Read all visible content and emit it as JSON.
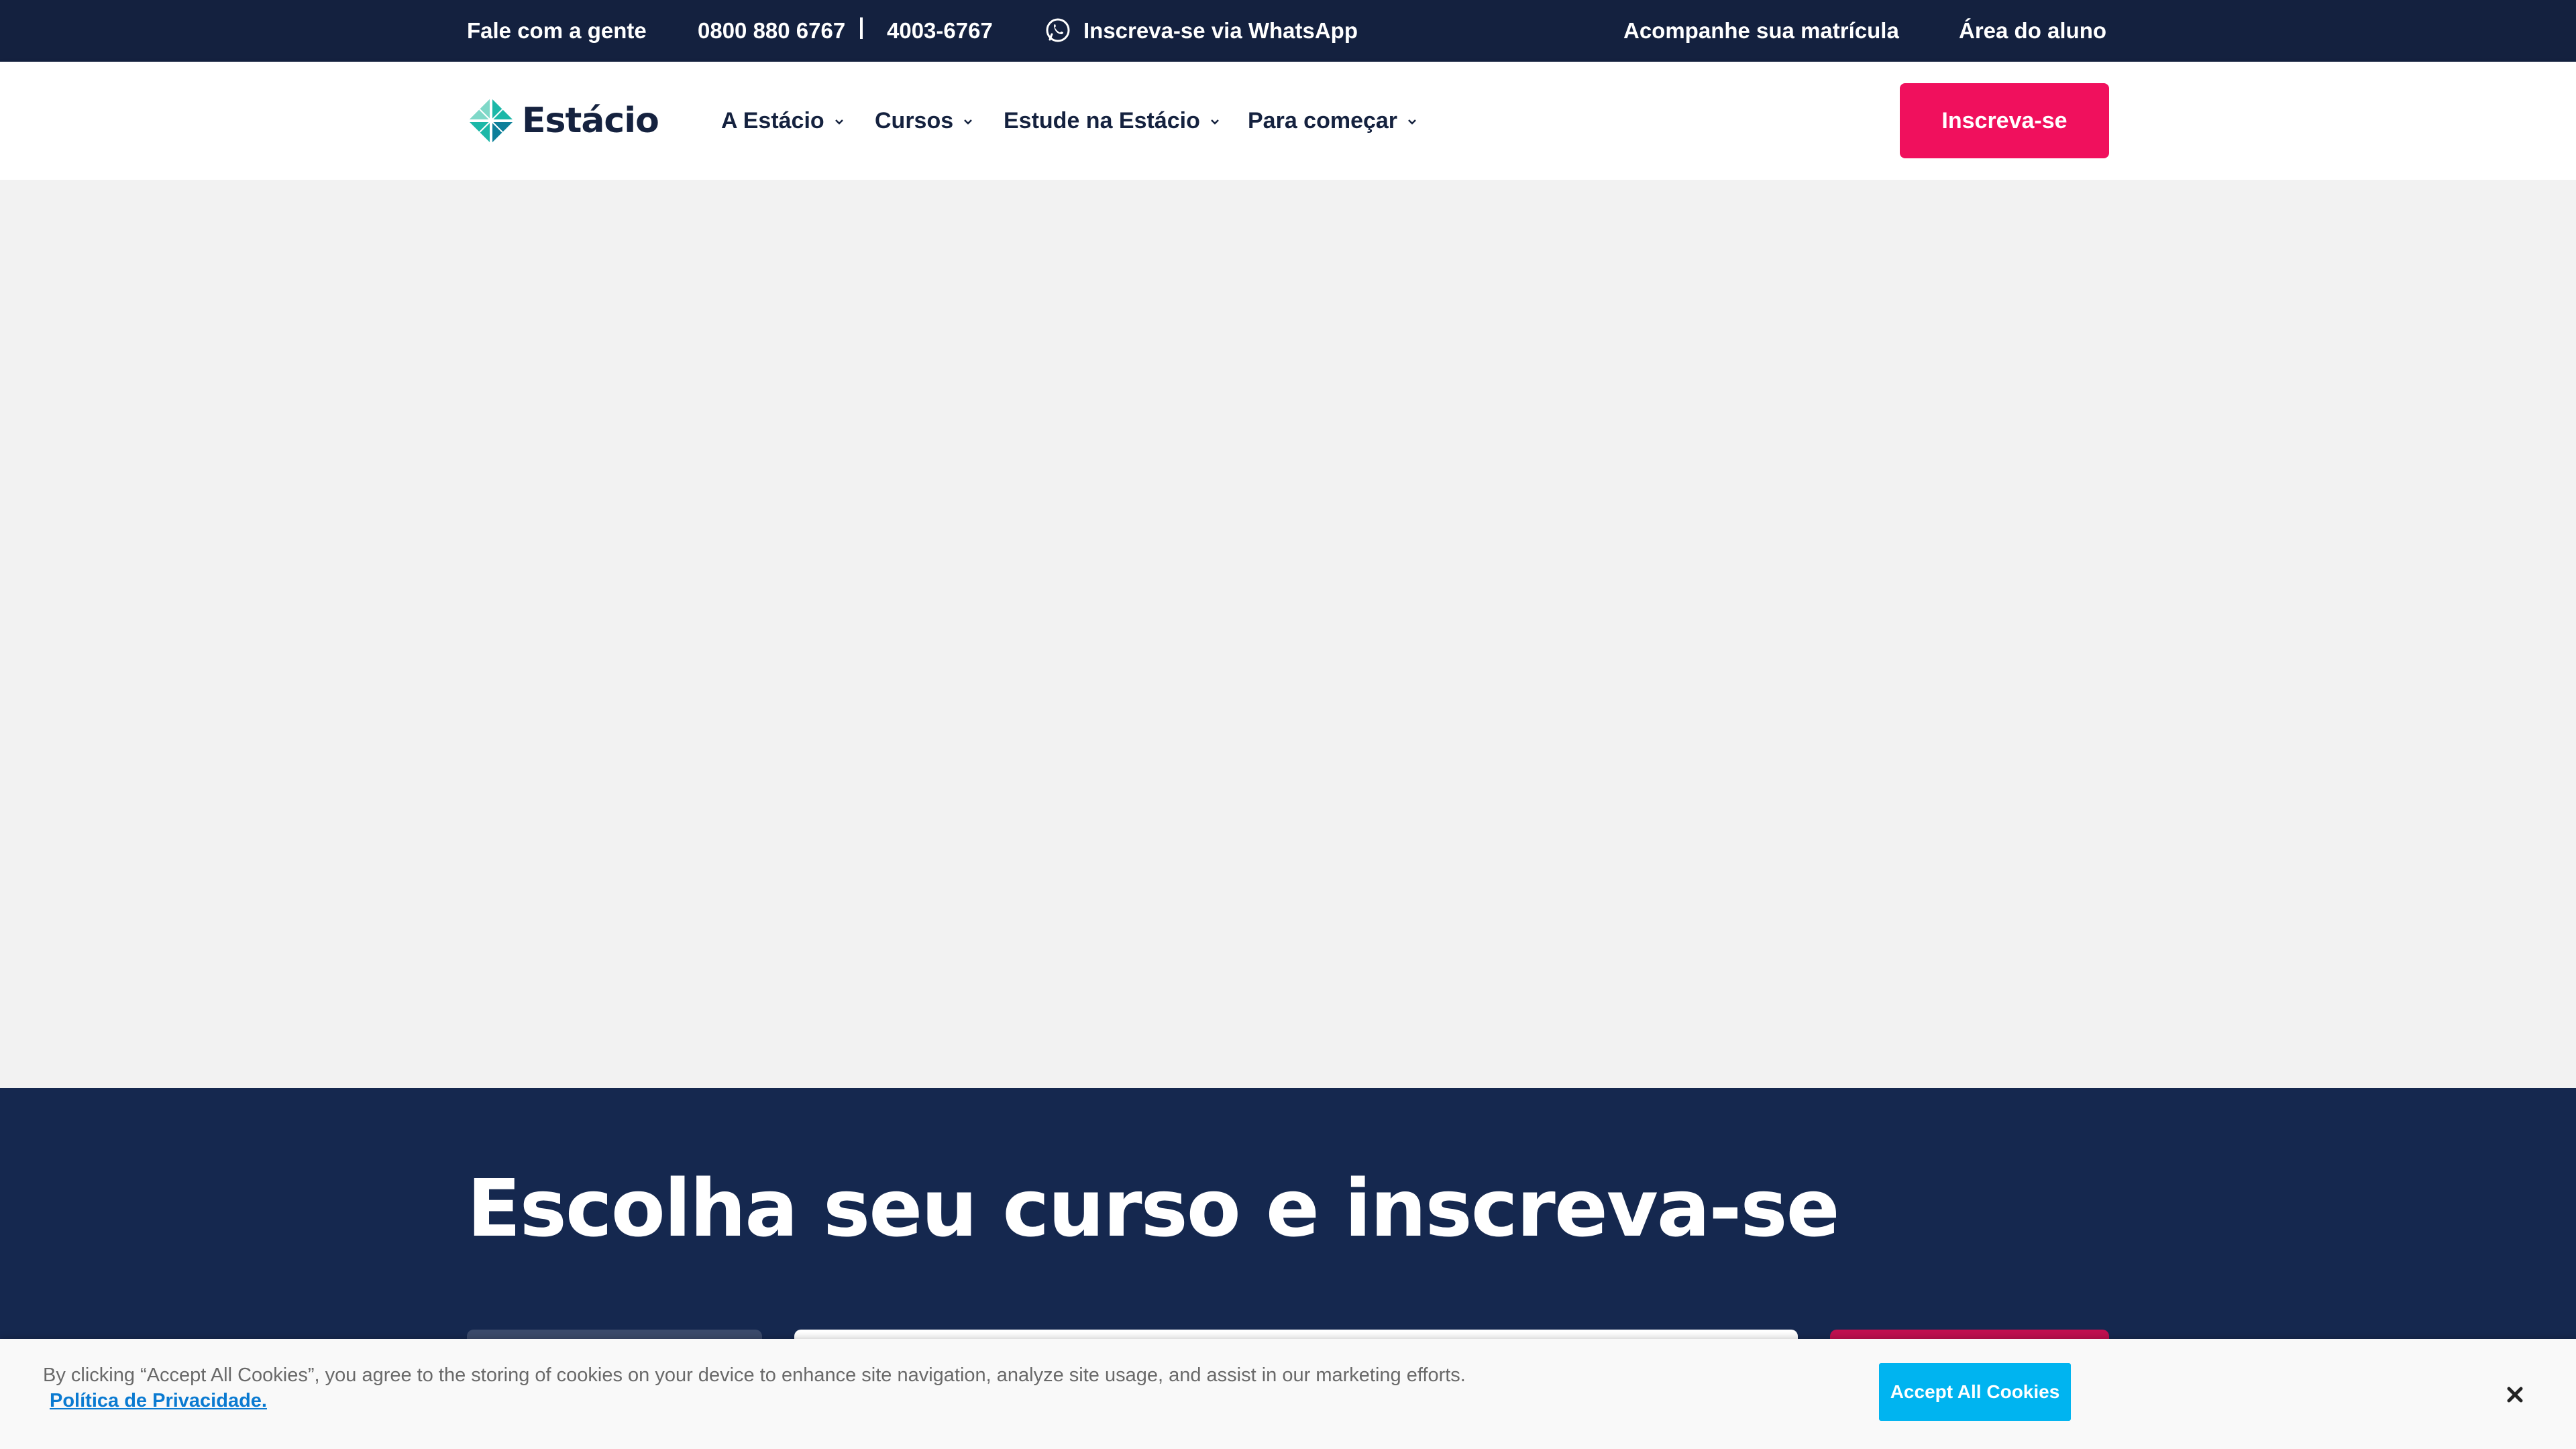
{
  "topbar": {
    "contact_label": "Fale com a gente",
    "phone_1": "0800 880 6767",
    "phone_2": "4003-6767",
    "whatsapp_label": "Inscreva-se via WhatsApp",
    "track_enrollment": "Acompanhe sua matrícula",
    "student_area": "Área do aluno"
  },
  "header": {
    "logo_text": "Estácio",
    "nav": [
      {
        "label": "A Estácio",
        "icon": "chevron-down-icon"
      },
      {
        "label": "Cursos",
        "icon": "chevron-down-icon"
      },
      {
        "label": "Estude na Estácio",
        "icon": "chevron-down-icon"
      },
      {
        "label": "Para começar",
        "icon": "chevron-down-icon"
      }
    ],
    "cta_label": "Inscreva-se"
  },
  "course_section": {
    "title": "Escolha seu curso e inscreva-se"
  },
  "cookie_banner": {
    "text": "By clicking “Accept All Cookies”, you agree to the storing of cookies on your device to enhance site navigation, analyze site usage, and assist in our marketing efforts.",
    "privacy_link": "Política de Privacidade.",
    "accept_label": "Accept All Cookies",
    "close_icon": "close-icon"
  },
  "colors": {
    "topbar_bg": "#14213f",
    "brand_pink": "#f0105d",
    "section_bg": "#15284f",
    "cookie_accept": "#00b4f0"
  }
}
